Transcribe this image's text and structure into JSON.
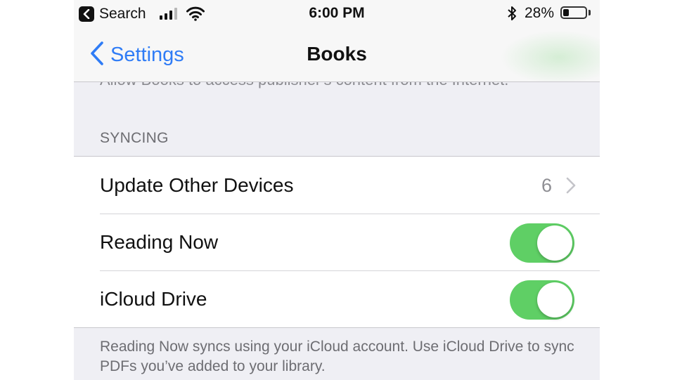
{
  "status_bar": {
    "back_app_label": "Search",
    "time": "6:00 PM",
    "battery_percent": "28%",
    "battery_level": 0.28,
    "icons": [
      "back-to-app-icon",
      "signal-icon",
      "wifi-icon",
      "bluetooth-icon",
      "battery-icon"
    ]
  },
  "nav": {
    "back_label": "Settings",
    "title": "Books"
  },
  "clipped_description": "Allow Books to access publisher's content from the Internet.",
  "syncing": {
    "header": "SYNCING",
    "rows": [
      {
        "label": "Update Other Devices",
        "value": "6",
        "type": "disclosure"
      },
      {
        "label": "Reading Now",
        "type": "toggle",
        "on": true
      },
      {
        "label": "iCloud Drive",
        "type": "toggle",
        "on": true
      }
    ],
    "footer": "Reading Now syncs using your iCloud account. Use iCloud Drive to sync PDFs you’ve added to your library."
  },
  "colors": {
    "accent": "#2f7cf6",
    "toggle_on": "#5fcf65",
    "grouped_background": "#efeff4"
  }
}
